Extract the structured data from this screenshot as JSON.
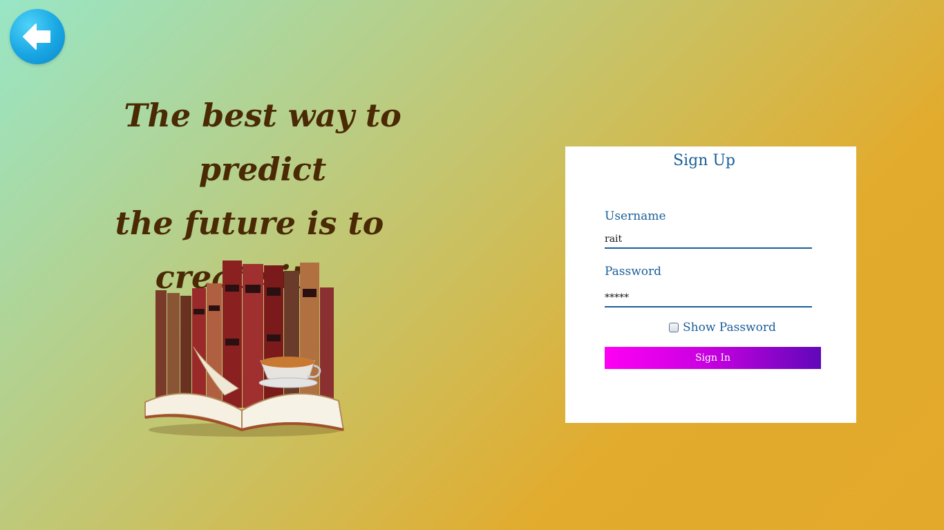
{
  "back": {
    "icon": "arrow-left-icon"
  },
  "quote": {
    "line1": "The best way to predict",
    "line2": "the future is to",
    "line3": "create it."
  },
  "illustration": {
    "icon": "books-and-coffee-illustration"
  },
  "signup": {
    "title": "Sign Up",
    "username_label": "Username",
    "username_value": "rait",
    "password_label": "Password",
    "password_value": "*****",
    "show_password_label": "Show Password",
    "show_password_checked": false,
    "sign_in_label": "Sign In"
  },
  "colors": {
    "accent": "#1a5e9a",
    "quote_text": "#4a2a05",
    "button_gradient_start": "#ff00f4",
    "button_gradient_end": "#6008b9",
    "back_button": "#18a6e3"
  }
}
